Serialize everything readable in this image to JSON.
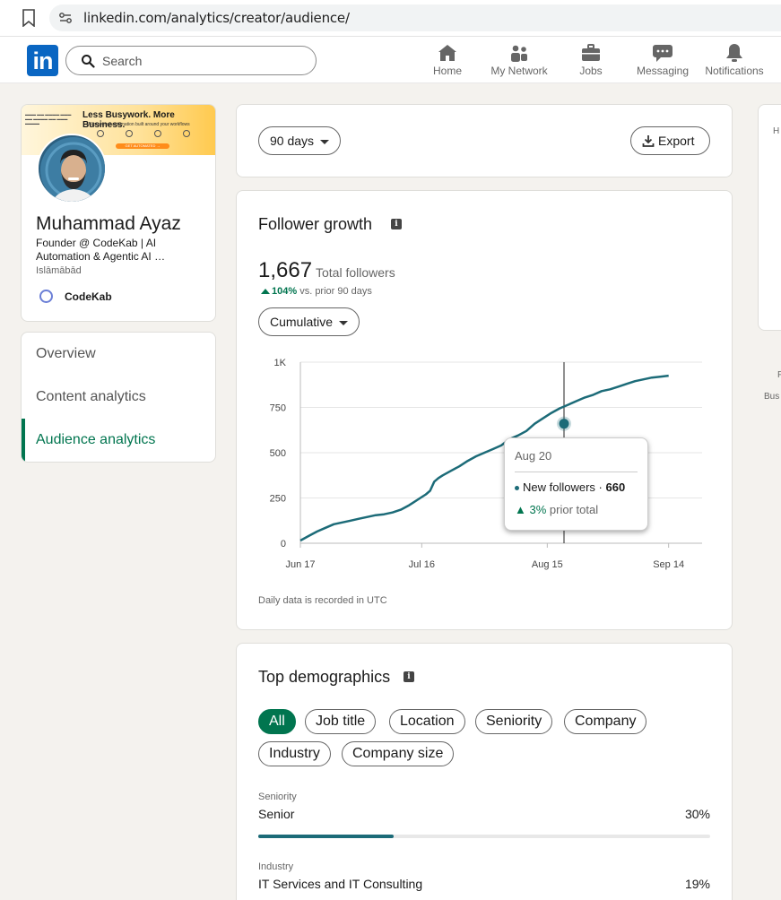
{
  "browser": {
    "url": "linkedin.com/analytics/creator/audience/"
  },
  "nav": {
    "search_placeholder": "Search",
    "items": [
      {
        "label": "Home",
        "icon": "home-icon"
      },
      {
        "label": "My Network",
        "icon": "people-icon"
      },
      {
        "label": "Jobs",
        "icon": "briefcase-icon"
      },
      {
        "label": "Messaging",
        "icon": "chat-icon"
      },
      {
        "label": "Notifications",
        "icon": "bell-icon"
      }
    ]
  },
  "profile": {
    "banner_title": "Less Busywork. More Business.",
    "banner_sub": "AI-powered automation built around your workflows",
    "banner_cta": "GET AUTOMATED →",
    "name": "Muhammad Ayaz",
    "headline": "Founder @ CodeKab | AI Automation & Agentic AI …",
    "location": "Islāmābād",
    "company": "CodeKab"
  },
  "sidebar": {
    "items": [
      {
        "label": "Overview"
      },
      {
        "label": "Content analytics"
      },
      {
        "label": "Audience analytics",
        "active": true
      }
    ]
  },
  "filters": {
    "range": "90 days",
    "export": "Export"
  },
  "growth": {
    "title": "Follower growth",
    "total": "1,667",
    "total_label": "Total followers",
    "change": "104%",
    "change_label": "vs. prior 90 days",
    "mode": "Cumulative",
    "footnote": "Daily data is recorded in UTC",
    "tooltip": {
      "date": "Aug 20",
      "label": "New followers ·",
      "value": "660",
      "change": "3%",
      "change_label": "prior total"
    }
  },
  "chart_data": {
    "type": "line",
    "title": "Follower growth",
    "xlabel": "",
    "ylabel": "",
    "ylim": [
      0,
      1000
    ],
    "yticks": [
      0,
      250,
      500,
      750,
      1000
    ],
    "ytick_labels": [
      "0",
      "250",
      "500",
      "750",
      "1K"
    ],
    "xtick_labels": [
      "Jun 17",
      "Jul 16",
      "Aug 15",
      "Sep 14"
    ],
    "xtick_days": [
      0,
      29,
      59,
      88
    ],
    "grid": true,
    "color": "#1c6b78",
    "series": [
      {
        "x_days": [
          0,
          2,
          4,
          6,
          8,
          10,
          12,
          14,
          16,
          18,
          20,
          22,
          24,
          26,
          27,
          28,
          29,
          30,
          31,
          32,
          33,
          34,
          36,
          38,
          40,
          42,
          44,
          46,
          48,
          50,
          52,
          54,
          56,
          58,
          60,
          62,
          64,
          66,
          68,
          70,
          72,
          74,
          76,
          78,
          80,
          82,
          84,
          86,
          88
        ],
        "values": [
          15,
          40,
          65,
          85,
          105,
          115,
          125,
          135,
          145,
          155,
          160,
          170,
          185,
          210,
          225,
          240,
          255,
          270,
          290,
          340,
          360,
          375,
          400,
          425,
          455,
          480,
          500,
          520,
          540,
          575,
          595,
          620,
          660,
          690,
          720,
          745,
          765,
          785,
          805,
          820,
          840,
          850,
          865,
          880,
          895,
          905,
          915,
          920,
          925
        ]
      }
    ],
    "highlight": {
      "x_day": 63,
      "value": 660
    }
  },
  "demographics": {
    "title": "Top demographics",
    "chips": [
      {
        "label": "All",
        "selected": true
      },
      {
        "label": "Job title"
      },
      {
        "label": "Location"
      },
      {
        "label": "Seniority"
      },
      {
        "label": "Company"
      },
      {
        "label": "Industry"
      },
      {
        "label": "Company size"
      }
    ],
    "rows": [
      {
        "category": "Seniority",
        "name": "Senior",
        "pct": "30%",
        "fraction": 0.3
      },
      {
        "category": "Industry",
        "name": "IT Services and IT Consulting",
        "pct": "19%",
        "fraction": 0.19
      }
    ]
  },
  "right_panel": {
    "t1": "H",
    "t2": "F",
    "t3": "Bus"
  }
}
